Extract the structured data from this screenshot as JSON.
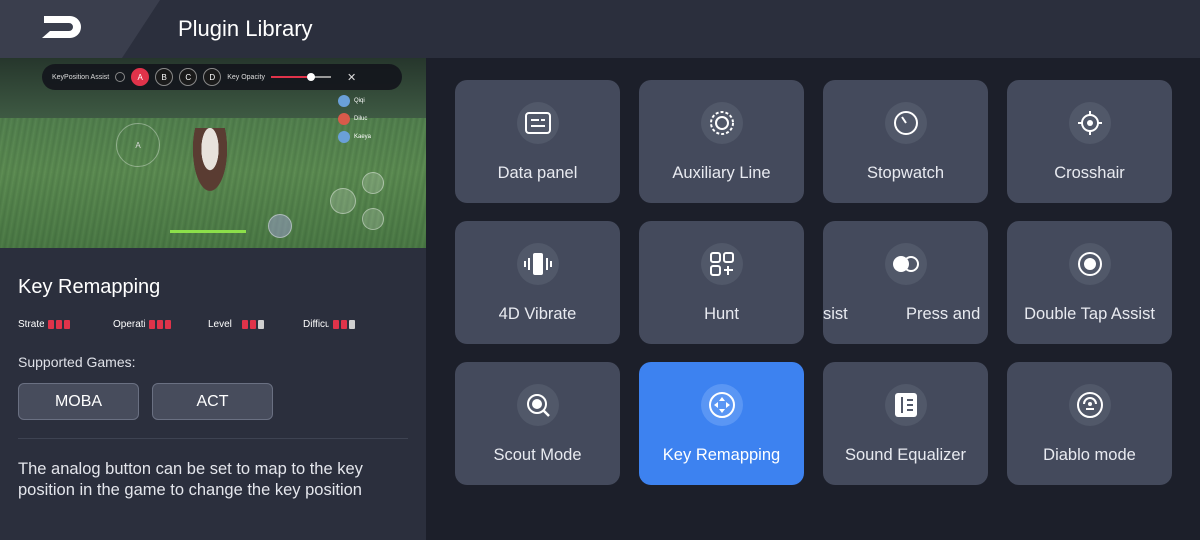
{
  "header": {
    "title": "Plugin Library",
    "back_icon": "back-arrow-icon"
  },
  "preview": {
    "overlay": {
      "label": "KeyPosition Assist",
      "keys": [
        "A",
        "B",
        "C",
        "D"
      ],
      "opacity_label": "Key Opacity",
      "opacity_value": 0.6
    },
    "joystick_label": "A",
    "party": [
      "Qiqi",
      "Diluc",
      "Kaeya"
    ]
  },
  "details": {
    "title": "Key Remapping",
    "ratings": [
      {
        "label": "Strategy",
        "filled": 3,
        "total": 3
      },
      {
        "label": "Operation",
        "filled": 3,
        "total": 3
      },
      {
        "label": "Level",
        "filled": 2,
        "total": 3
      },
      {
        "label": "Difficulty",
        "filled": 2,
        "total": 3
      }
    ],
    "supported_label": "Supported Games:",
    "games": [
      "MOBA",
      "ACT"
    ],
    "description": "The analog button can be set to map to the key position in the game to change the key position"
  },
  "plugins": [
    {
      "label": "Data panel",
      "icon": "data-panel-icon"
    },
    {
      "label": "Auxiliary Line",
      "icon": "auxiliary-line-icon"
    },
    {
      "label": "Stopwatch",
      "icon": "stopwatch-icon"
    },
    {
      "label": "Crosshair",
      "icon": "crosshair-icon"
    },
    {
      "label": "4D Vibrate",
      "icon": "vibrate-icon"
    },
    {
      "label": "Hunt",
      "icon": "hunt-icon"
    },
    {
      "label": "Press and Hold Assist",
      "icon": "press-hold-icon",
      "marquee_visible": [
        "sist",
        "Press and"
      ]
    },
    {
      "label": "Double Tap Assist",
      "icon": "double-tap-icon"
    },
    {
      "label": "Scout Mode",
      "icon": "scout-mode-icon"
    },
    {
      "label": "Key Remapping",
      "icon": "key-remapping-icon",
      "selected": true
    },
    {
      "label": "Sound Equalizer",
      "icon": "sound-equalizer-icon"
    },
    {
      "label": "Diablo mode",
      "icon": "diablo-mode-icon"
    }
  ],
  "colors": {
    "accent": "#3d82f0",
    "rating_on": "#e0334a",
    "tile": "#444a5c"
  }
}
